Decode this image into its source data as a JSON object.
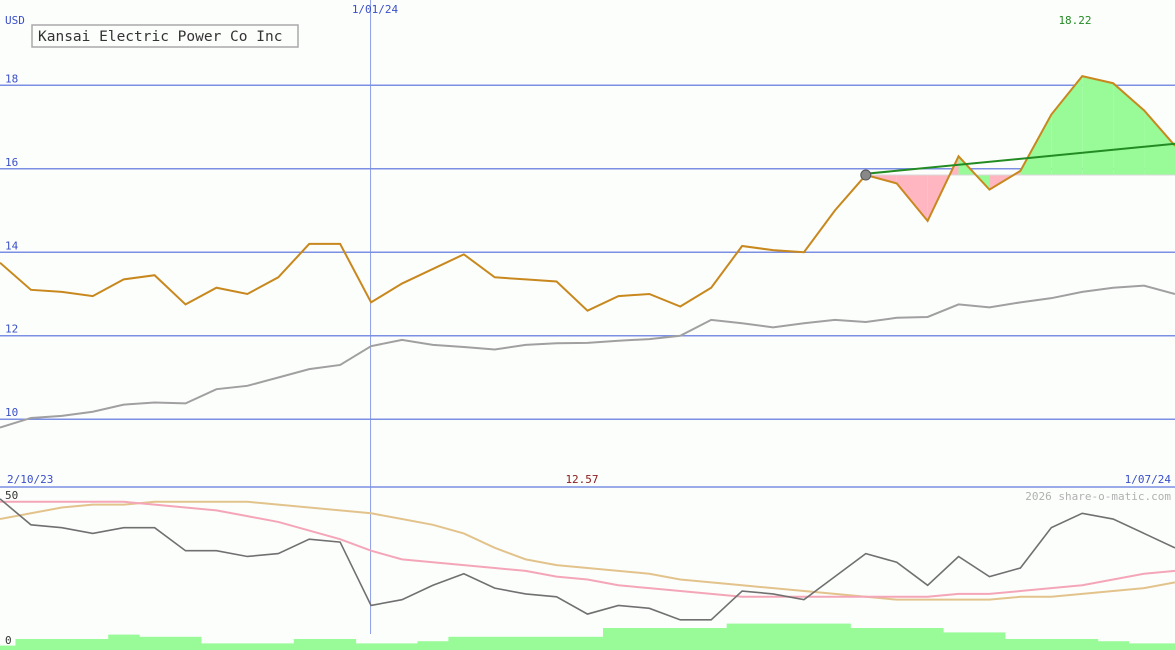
{
  "chart_data": {
    "type": "line",
    "title": "Kansai Electric Power Co Inc",
    "currency_label": "USD",
    "date_marker": "1/01/24",
    "start_date": "2/10/23",
    "end_date": "1/07/24",
    "high_label": "18.22",
    "low_label": "12.57",
    "copyright": "2026 share-o-matic.com",
    "price_axis": {
      "ticks": [
        "10",
        "12",
        "14",
        "16",
        "18"
      ],
      "ylim": [
        8.4,
        19.9
      ]
    },
    "osc_axis": {
      "ticks": [
        "50",
        "0"
      ],
      "ylim": [
        0,
        50
      ]
    },
    "colors": {
      "price": "#c8881e",
      "average": "#a0a0a0",
      "trend": "#228b22",
      "gain_fill": "#98fb98",
      "loss_fill": "#ffb6c1",
      "grid": "#7b8fe3",
      "axis_text": "#3a4fc8",
      "high_text": "#228b22",
      "low_text": "#8b1a1a",
      "oscillator": "#707070",
      "osc_fast": "#f4a6b8",
      "osc_slow": "#e3c38c",
      "volume": "#98fb98"
    },
    "series": [
      {
        "role": "price",
        "values": [
          13.75,
          13.1,
          13.05,
          12.95,
          13.35,
          13.45,
          12.75,
          13.15,
          13.0,
          13.4,
          14.2,
          14.2,
          12.8,
          13.25,
          13.6,
          13.95,
          13.4,
          13.35,
          13.3,
          12.6,
          12.95,
          13.0,
          12.7,
          13.15,
          14.15,
          14.05,
          14.0,
          15.0,
          15.85,
          15.65,
          14.75,
          16.3,
          15.5,
          15.95,
          17.3,
          18.22,
          18.05,
          17.4,
          16.55
        ]
      },
      {
        "role": "average",
        "values": [
          9.8,
          10.03,
          10.08,
          10.18,
          10.35,
          10.4,
          10.38,
          10.72,
          10.8,
          11.0,
          11.2,
          11.3,
          11.75,
          11.9,
          11.78,
          11.73,
          11.67,
          11.78,
          11.82,
          11.83,
          11.88,
          11.92,
          12.0,
          12.38,
          12.3,
          12.2,
          12.3,
          12.38,
          12.33,
          12.43,
          12.45,
          12.75,
          12.68,
          12.8,
          12.9,
          13.05,
          13.15,
          13.2,
          13.0
        ]
      },
      {
        "role": "trend",
        "values": [
          15.88,
          16.6
        ]
      },
      {
        "role": "oscillator",
        "values": [
          49,
          40,
          39,
          37,
          39,
          39,
          31,
          31,
          29,
          30,
          35,
          34,
          12,
          14,
          19,
          23,
          18,
          16,
          15,
          9,
          12,
          11,
          7,
          7,
          17,
          16,
          14,
          22,
          30,
          27,
          19,
          29,
          22,
          25,
          39,
          44,
          42,
          37,
          32
        ]
      },
      {
        "role": "osc_fast",
        "values": [
          48,
          48,
          48,
          48,
          48,
          47,
          46,
          45,
          43,
          41,
          38,
          35,
          31,
          28,
          27,
          26,
          25,
          24,
          22,
          21,
          19,
          18,
          17,
          16,
          15,
          15,
          15,
          15,
          15,
          15,
          15,
          16,
          16,
          17,
          18,
          19,
          21,
          23,
          24
        ]
      },
      {
        "role": "osc_slow",
        "values": [
          42,
          44,
          46,
          47,
          47,
          48,
          48,
          48,
          48,
          47,
          46,
          45,
          44,
          42,
          40,
          37,
          32,
          28,
          26,
          25,
          24,
          23,
          21,
          20,
          19,
          18,
          17,
          16,
          15,
          14,
          14,
          14,
          14,
          15,
          15,
          16,
          17,
          18,
          20
        ]
      },
      {
        "role": "volume",
        "values": [
          2,
          5,
          5,
          5,
          7,
          6,
          6,
          3,
          3,
          3,
          5,
          5,
          3,
          3,
          4,
          6,
          6,
          6,
          6,
          6,
          10,
          10,
          10,
          10,
          12,
          12,
          12,
          12,
          10,
          10,
          10,
          8,
          8,
          5,
          5,
          5,
          4,
          3,
          3
        ]
      }
    ]
  }
}
